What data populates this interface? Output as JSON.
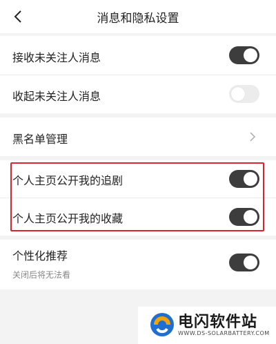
{
  "header": {
    "title": "消息和隐私设置",
    "back_icon": "chevron-left-icon"
  },
  "settings": [
    {
      "label": "接收未关注人消息",
      "control": "toggle",
      "state": "on"
    },
    {
      "label": "收起未关注人消息",
      "control": "toggle",
      "state": "off"
    },
    {
      "label": "黑名单管理",
      "control": "chevron",
      "icon": "chevron-right-icon"
    },
    {
      "label": "个人主页公开我的追剧",
      "control": "toggle",
      "state": "on"
    },
    {
      "label": "个人主页公开我的收藏",
      "control": "toggle",
      "state": "on"
    },
    {
      "label": "个性化推荐",
      "sublabel": "关闭后将无法看",
      "control": "toggle",
      "state": "on"
    }
  ],
  "watermark": {
    "name": "电闪软件站",
    "url": "WWW.DS-SOLARBATTERY.COM"
  },
  "colors": {
    "toggle_on": "#3d3d3d",
    "toggle_off": "#ececec",
    "highlight": "#d9232f",
    "background": "#f3f3f3"
  }
}
